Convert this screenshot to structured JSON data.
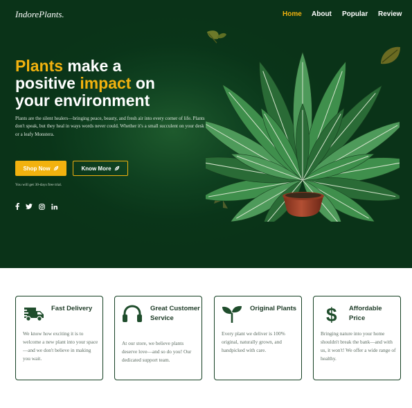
{
  "brand": "IndorePlants.",
  "nav": {
    "items": [
      {
        "label": "Home",
        "active": true
      },
      {
        "label": "About",
        "active": false
      },
      {
        "label": "Popular",
        "active": false
      },
      {
        "label": "Review",
        "active": false
      }
    ]
  },
  "hero": {
    "headline": {
      "word1": "Plants",
      "word2": " make a",
      "word3": "positive ",
      "word4": "impact",
      "word5": " on",
      "word6": "your environment"
    },
    "description": "Plants are the silent healers—bringing peace, beauty, and fresh air into every corner of life. Plants don't speak, but they heal in ways words never could. Whether it's a small succulent on your desk or a leafy Monstera.",
    "primary_button": "Shop Now",
    "secondary_button": "Know More",
    "trial_note": "You will get 30-days free trial.",
    "social_icons": [
      "facebook-icon",
      "twitter-icon",
      "instagram-icon",
      "linkedin-icon"
    ]
  },
  "features": [
    {
      "icon": "delivery-truck-icon",
      "title": "Fast Delivery",
      "text": "We know how exciting it is to welcome a new plant into your space—and we don't believe in making you wait."
    },
    {
      "icon": "headphones-icon",
      "title": "Great Customer Service",
      "text": "At our store, we believe plants deserve love—and so do you! Our dedicated support team."
    },
    {
      "icon": "sprout-icon",
      "title": "Original Plants",
      "text": "Every plant we deliver is 100% original, naturally grown, and handpicked with care."
    },
    {
      "icon": "dollar-icon",
      "title": "Affordable Price",
      "text": "Bringing nature into your home shouldn't break the bank—and with us, it won't! We offer a wide range of healthy."
    }
  ],
  "colors": {
    "hero_bg": "#0a3519",
    "accent": "#f2b20f",
    "card_border": "#143f22",
    "icon_green": "#1f4d2c"
  }
}
